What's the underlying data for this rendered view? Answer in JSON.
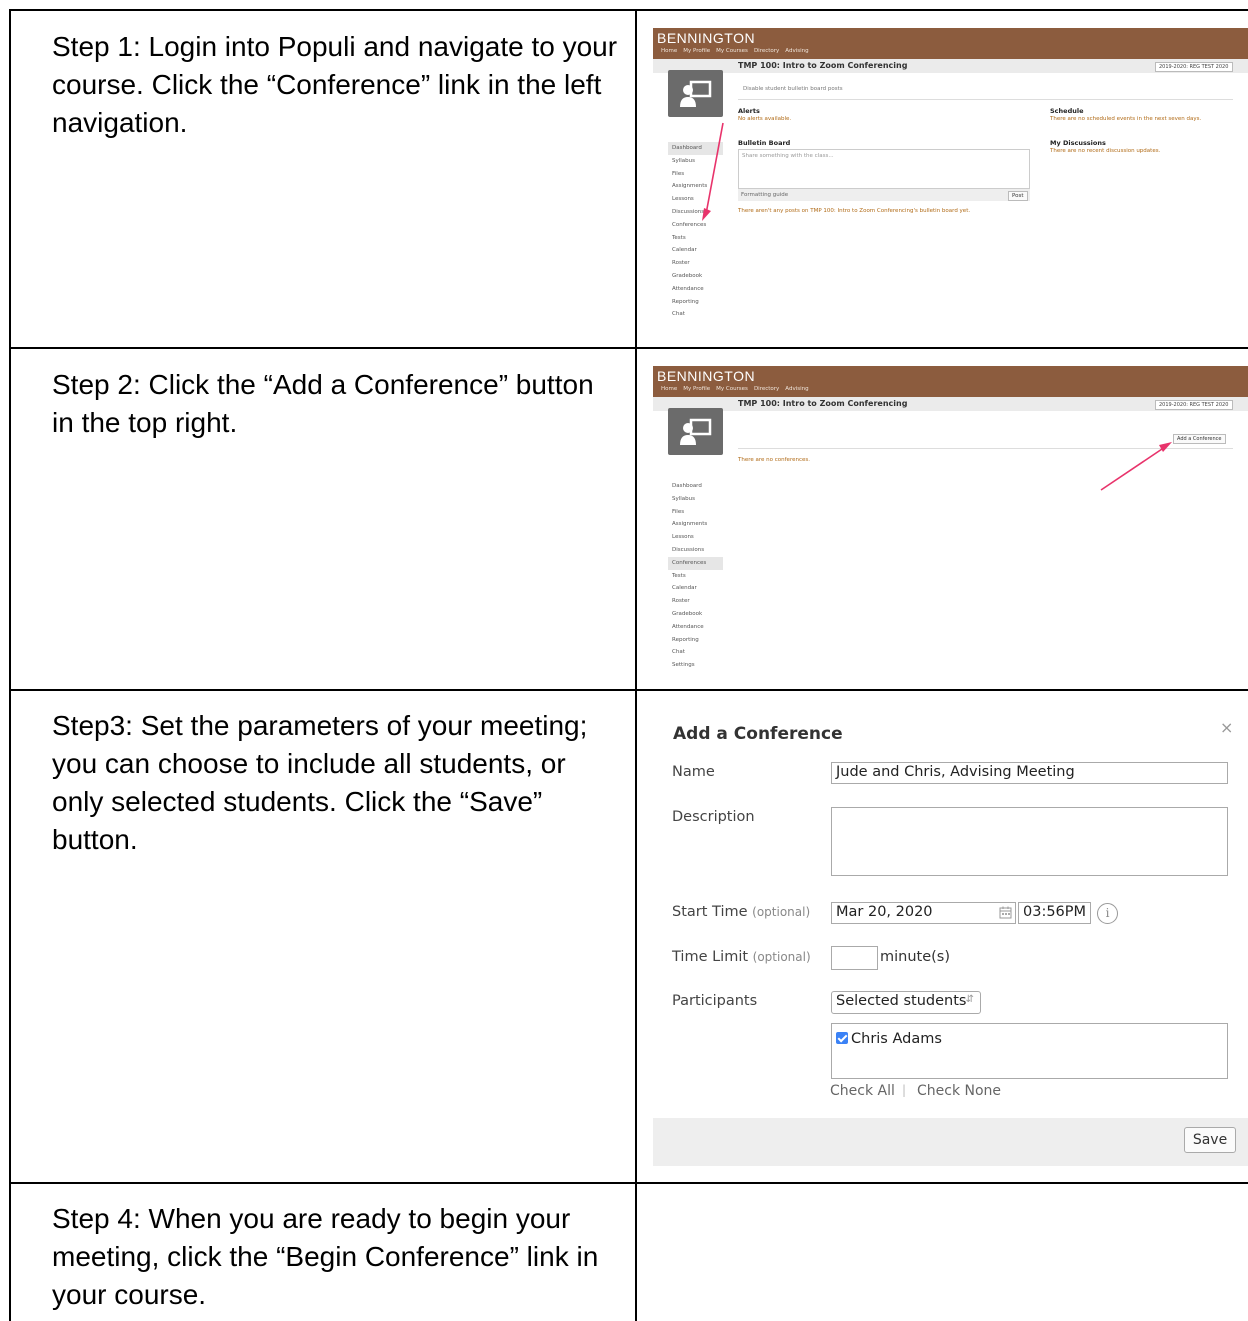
{
  "steps": [
    {
      "text": "Step 1: Login into Populi and navigate to your course. Click the “Conference” link in the left navigation."
    },
    {
      "text": "Step 2: Click the “Add a Conference” button in the top right."
    },
    {
      "text": "Step3: Set the parameters of your meeting; you can choose to include all students, or only selected students. Click the “Save” button."
    },
    {
      "text": "Step 4: When you are ready to begin your meeting, click the “Begin Conference” link in your course."
    }
  ],
  "populi": {
    "logo": "BENNINGTON",
    "nav": [
      "Home",
      "My Profile",
      "My Courses",
      "Directory",
      "Advising"
    ],
    "course_title": "TMP 100: Intro to Zoom Conferencing",
    "term": "2019-2020: REG TEST 2020",
    "sidebar": [
      "Dashboard",
      "Syllabus",
      "Files",
      "Assignments",
      "Lessons",
      "Discussions",
      "Conferences",
      "Tests",
      "Calendar",
      "Roster",
      "Gradebook",
      "Attendance",
      "Reporting",
      "Chat",
      "Settings"
    ],
    "accent_color": "#8c5c3e",
    "arrow_color": "#e8336b"
  },
  "shot1": {
    "disable_posts": "Disable student bulletin board posts",
    "alerts_title": "Alerts",
    "alerts_text": "No alerts available.",
    "schedule_title": "Schedule",
    "schedule_text": "There are no scheduled events in the next seven days.",
    "bulletin_title": "Bulletin Board",
    "bulletin_placeholder": "Share something with the class...",
    "formatting_guide": "Formatting guide",
    "post_button": "Post",
    "discussions_title": "My Discussions",
    "discussions_text": "There are no recent discussion updates.",
    "no_posts": "There aren't any posts on TMP 100: Intro to Zoom Conferencing's bulletin board yet."
  },
  "shot2": {
    "add_button": "Add a Conference",
    "no_conferences": "There are no conferences."
  },
  "dialog": {
    "title": "Add a Conference",
    "close": "×",
    "name_label": "Name",
    "name_value": "Jude and Chris, Advising Meeting",
    "description_label": "Description",
    "description_value": "",
    "start_label": "Start Time",
    "optional": "(optional)",
    "start_date": "Mar 20, 2020",
    "start_time": "03:56PM",
    "info_icon": "i",
    "time_limit_label": "Time Limit",
    "time_limit_value": "",
    "minutes_label": "minute(s)",
    "participants_label": "Participants",
    "participants_value": "Selected students",
    "students": [
      {
        "name": "Chris Adams",
        "checked": true
      }
    ],
    "check_all": "Check All",
    "separator": "|",
    "check_none": "Check None",
    "save": "Save"
  }
}
